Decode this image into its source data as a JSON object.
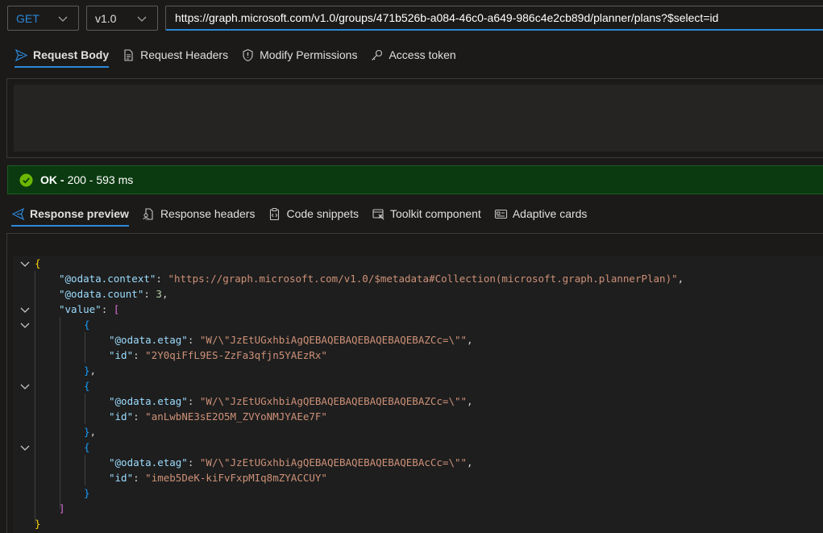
{
  "request": {
    "method": "GET",
    "version": "v1.0",
    "url": "https://graph.microsoft.com/v1.0/groups/471b526b-a084-46c0-a649-986c4e2cb89d/planner/plans?$select=id"
  },
  "request_tabs": [
    "Request Body",
    "Request Headers",
    "Modify Permissions",
    "Access token"
  ],
  "status": {
    "label": "OK -",
    "detail": "200 - 593 ms"
  },
  "response_tabs": [
    "Response preview",
    "Response headers",
    "Code snippets",
    "Toolkit component",
    "Adaptive cards"
  ],
  "response_json": {
    "context_key": "\"@odata.context\"",
    "context_value": "\"https://graph.microsoft.com/v1.0/$metadata#Collection(microsoft.graph.plannerPlan)\"",
    "count_key": "\"@odata.count\"",
    "count_value": "3",
    "value_key": "\"value\"",
    "etag_key": "\"@odata.etag\"",
    "id_key": "\"id\"",
    "items": [
      {
        "etag": "\"W/\\\"JzEtUGxhbiAgQEBAQEBAQEBAQEBAQEBAZCc=\\\"\"",
        "id": "\"2Y0qiFfL9ES-ZzFa3qfjn5YAEzRx\""
      },
      {
        "etag": "\"W/\\\"JzEtUGxhbiAgQEBAQEBAQEBAQEBAQEBAZCc=\\\"\"",
        "id": "\"anLwbNE3sE2O5M_ZVYoNMJYAEe7F\""
      },
      {
        "etag": "\"W/\\\"JzEtUGxhbiAgQEBAQEBAQEBAQEBAQEBAcCc=\\\"\"",
        "id": "\"imeb5DeK-kiFvFxpMIq8mZYACCUY\""
      }
    ]
  }
}
